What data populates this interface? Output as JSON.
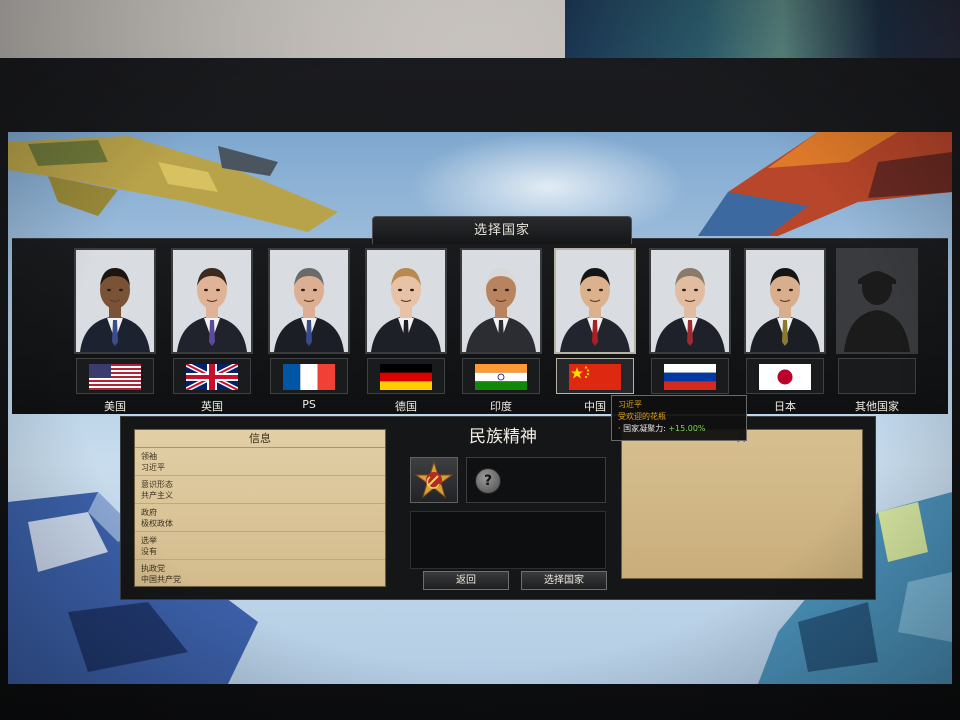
{
  "screen_title": "选择国家",
  "countries": [
    {
      "name": "美国",
      "flag": "usa",
      "skin": "#7a5236",
      "hair": "#1c140e",
      "suit": "#1d2230",
      "tie": "#3b4c8a"
    },
    {
      "name": "英国",
      "flag": "uk",
      "skin": "#e0b397",
      "hair": "#3a2a20",
      "suit": "#20232c",
      "tie": "#5d4a9a"
    },
    {
      "name": "PS",
      "flag": "france",
      "skin": "#dcae92",
      "hair": "#6a6a6a",
      "suit": "#1c1e26",
      "tie": "#3a4b8a"
    },
    {
      "name": "德国",
      "flag": "germany",
      "skin": "#e8c2a6",
      "hair": "#b88a52",
      "suit": "#1e2028",
      "tie": "#1e2028"
    },
    {
      "name": "印度",
      "flag": "india",
      "skin": "#b88460",
      "hair": "#d8d8d8",
      "suit": "#2b2d33",
      "tie": "#2b2d33"
    },
    {
      "name": "中国",
      "flag": "china",
      "skin": "#dcb28e",
      "hair": "#151515",
      "suit": "#22252e",
      "tie": "#a81f24"
    },
    {
      "name": "",
      "flag": "russia",
      "skin": "#e2bca0",
      "hair": "#8a7a6a",
      "suit": "#1e212a",
      "tie": "#9c2a2e"
    },
    {
      "name": "日本",
      "flag": "japan",
      "skin": "#d8ae8c",
      "hair": "#151515",
      "suit": "#1c1e26",
      "tie": "#8a7a30"
    },
    {
      "name": "其他国家",
      "flag": "none",
      "skin": "#2a2a2a",
      "hair": "#1e1e1e",
      "suit": "#1e1e1e",
      "tie": "#1e1e1e"
    }
  ],
  "selected_index": 5,
  "info": {
    "title": "信息",
    "rows": [
      {
        "key": "领袖",
        "value": "习近平"
      },
      {
        "key": "意识形态",
        "value": "共产主义"
      },
      {
        "key": "政府",
        "value": "极权政体"
      },
      {
        "key": "选举",
        "value": "没有"
      },
      {
        "key": "执政党",
        "value": "中国共产党"
      }
    ]
  },
  "national_spirit": {
    "title": "民族精神",
    "icon": "hammer-sickle-star-icon",
    "help_glyph": "?"
  },
  "buttons": {
    "back": "返回",
    "select": "选择国家"
  },
  "description": {
    "title_fragment": "介"
  },
  "tooltip": {
    "name": "习近平",
    "trait": "受欢迎的花瓶",
    "effect_label": "· 国家凝聚力:",
    "effect_value": "+15.00%"
  },
  "colors": {
    "gold_accent": "#e2a21c",
    "positive_green": "#7bdb53",
    "parchment": "#d7bf90"
  }
}
